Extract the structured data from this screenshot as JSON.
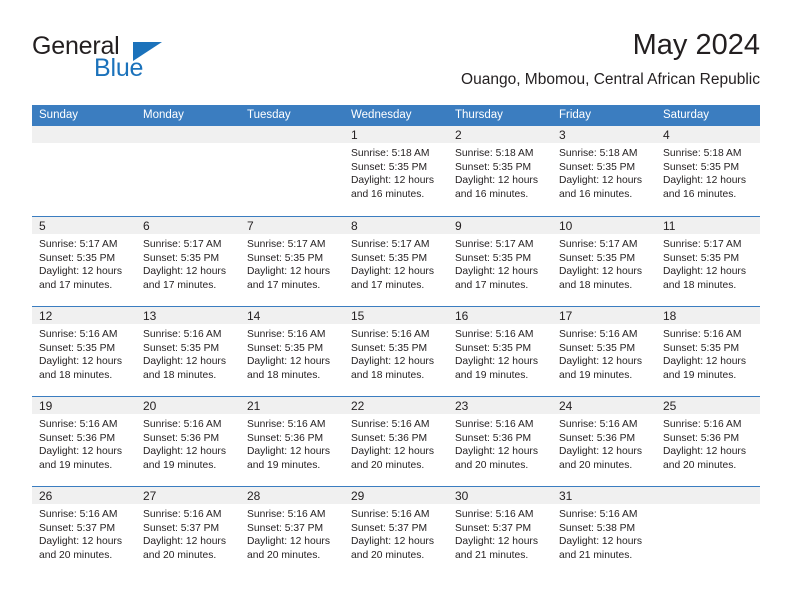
{
  "brand": {
    "name_part1": "General",
    "name_part2": "Blue",
    "logo_icon": "triangle-icon"
  },
  "header": {
    "month_title": "May 2024",
    "location": "Ouango, Mbomou, Central African Republic"
  },
  "colors": {
    "header_blue": "#3b7dc0",
    "brand_blue": "#1b72bb",
    "day_band_gray": "#f0f0f0",
    "text": "#231f20"
  },
  "weekdays": [
    "Sunday",
    "Monday",
    "Tuesday",
    "Wednesday",
    "Thursday",
    "Friday",
    "Saturday"
  ],
  "weeks": [
    [
      {
        "empty": true
      },
      {
        "empty": true
      },
      {
        "empty": true
      },
      {
        "day": "1",
        "sunrise": "Sunrise: 5:18 AM",
        "sunset": "Sunset: 5:35 PM",
        "daylight": "Daylight: 12 hours and 16 minutes."
      },
      {
        "day": "2",
        "sunrise": "Sunrise: 5:18 AM",
        "sunset": "Sunset: 5:35 PM",
        "daylight": "Daylight: 12 hours and 16 minutes."
      },
      {
        "day": "3",
        "sunrise": "Sunrise: 5:18 AM",
        "sunset": "Sunset: 5:35 PM",
        "daylight": "Daylight: 12 hours and 16 minutes."
      },
      {
        "day": "4",
        "sunrise": "Sunrise: 5:18 AM",
        "sunset": "Sunset: 5:35 PM",
        "daylight": "Daylight: 12 hours and 16 minutes."
      }
    ],
    [
      {
        "day": "5",
        "sunrise": "Sunrise: 5:17 AM",
        "sunset": "Sunset: 5:35 PM",
        "daylight": "Daylight: 12 hours and 17 minutes."
      },
      {
        "day": "6",
        "sunrise": "Sunrise: 5:17 AM",
        "sunset": "Sunset: 5:35 PM",
        "daylight": "Daylight: 12 hours and 17 minutes."
      },
      {
        "day": "7",
        "sunrise": "Sunrise: 5:17 AM",
        "sunset": "Sunset: 5:35 PM",
        "daylight": "Daylight: 12 hours and 17 minutes."
      },
      {
        "day": "8",
        "sunrise": "Sunrise: 5:17 AM",
        "sunset": "Sunset: 5:35 PM",
        "daylight": "Daylight: 12 hours and 17 minutes."
      },
      {
        "day": "9",
        "sunrise": "Sunrise: 5:17 AM",
        "sunset": "Sunset: 5:35 PM",
        "daylight": "Daylight: 12 hours and 17 minutes."
      },
      {
        "day": "10",
        "sunrise": "Sunrise: 5:17 AM",
        "sunset": "Sunset: 5:35 PM",
        "daylight": "Daylight: 12 hours and 18 minutes."
      },
      {
        "day": "11",
        "sunrise": "Sunrise: 5:17 AM",
        "sunset": "Sunset: 5:35 PM",
        "daylight": "Daylight: 12 hours and 18 minutes."
      }
    ],
    [
      {
        "day": "12",
        "sunrise": "Sunrise: 5:16 AM",
        "sunset": "Sunset: 5:35 PM",
        "daylight": "Daylight: 12 hours and 18 minutes."
      },
      {
        "day": "13",
        "sunrise": "Sunrise: 5:16 AM",
        "sunset": "Sunset: 5:35 PM",
        "daylight": "Daylight: 12 hours and 18 minutes."
      },
      {
        "day": "14",
        "sunrise": "Sunrise: 5:16 AM",
        "sunset": "Sunset: 5:35 PM",
        "daylight": "Daylight: 12 hours and 18 minutes."
      },
      {
        "day": "15",
        "sunrise": "Sunrise: 5:16 AM",
        "sunset": "Sunset: 5:35 PM",
        "daylight": "Daylight: 12 hours and 18 minutes."
      },
      {
        "day": "16",
        "sunrise": "Sunrise: 5:16 AM",
        "sunset": "Sunset: 5:35 PM",
        "daylight": "Daylight: 12 hours and 19 minutes."
      },
      {
        "day": "17",
        "sunrise": "Sunrise: 5:16 AM",
        "sunset": "Sunset: 5:35 PM",
        "daylight": "Daylight: 12 hours and 19 minutes."
      },
      {
        "day": "18",
        "sunrise": "Sunrise: 5:16 AM",
        "sunset": "Sunset: 5:35 PM",
        "daylight": "Daylight: 12 hours and 19 minutes."
      }
    ],
    [
      {
        "day": "19",
        "sunrise": "Sunrise: 5:16 AM",
        "sunset": "Sunset: 5:36 PM",
        "daylight": "Daylight: 12 hours and 19 minutes."
      },
      {
        "day": "20",
        "sunrise": "Sunrise: 5:16 AM",
        "sunset": "Sunset: 5:36 PM",
        "daylight": "Daylight: 12 hours and 19 minutes."
      },
      {
        "day": "21",
        "sunrise": "Sunrise: 5:16 AM",
        "sunset": "Sunset: 5:36 PM",
        "daylight": "Daylight: 12 hours and 19 minutes."
      },
      {
        "day": "22",
        "sunrise": "Sunrise: 5:16 AM",
        "sunset": "Sunset: 5:36 PM",
        "daylight": "Daylight: 12 hours and 20 minutes."
      },
      {
        "day": "23",
        "sunrise": "Sunrise: 5:16 AM",
        "sunset": "Sunset: 5:36 PM",
        "daylight": "Daylight: 12 hours and 20 minutes."
      },
      {
        "day": "24",
        "sunrise": "Sunrise: 5:16 AM",
        "sunset": "Sunset: 5:36 PM",
        "daylight": "Daylight: 12 hours and 20 minutes."
      },
      {
        "day": "25",
        "sunrise": "Sunrise: 5:16 AM",
        "sunset": "Sunset: 5:36 PM",
        "daylight": "Daylight: 12 hours and 20 minutes."
      }
    ],
    [
      {
        "day": "26",
        "sunrise": "Sunrise: 5:16 AM",
        "sunset": "Sunset: 5:37 PM",
        "daylight": "Daylight: 12 hours and 20 minutes."
      },
      {
        "day": "27",
        "sunrise": "Sunrise: 5:16 AM",
        "sunset": "Sunset: 5:37 PM",
        "daylight": "Daylight: 12 hours and 20 minutes."
      },
      {
        "day": "28",
        "sunrise": "Sunrise: 5:16 AM",
        "sunset": "Sunset: 5:37 PM",
        "daylight": "Daylight: 12 hours and 20 minutes."
      },
      {
        "day": "29",
        "sunrise": "Sunrise: 5:16 AM",
        "sunset": "Sunset: 5:37 PM",
        "daylight": "Daylight: 12 hours and 20 minutes."
      },
      {
        "day": "30",
        "sunrise": "Sunrise: 5:16 AM",
        "sunset": "Sunset: 5:37 PM",
        "daylight": "Daylight: 12 hours and 21 minutes."
      },
      {
        "day": "31",
        "sunrise": "Sunrise: 5:16 AM",
        "sunset": "Sunset: 5:38 PM",
        "daylight": "Daylight: 12 hours and 21 minutes."
      },
      {
        "empty": true
      }
    ]
  ]
}
